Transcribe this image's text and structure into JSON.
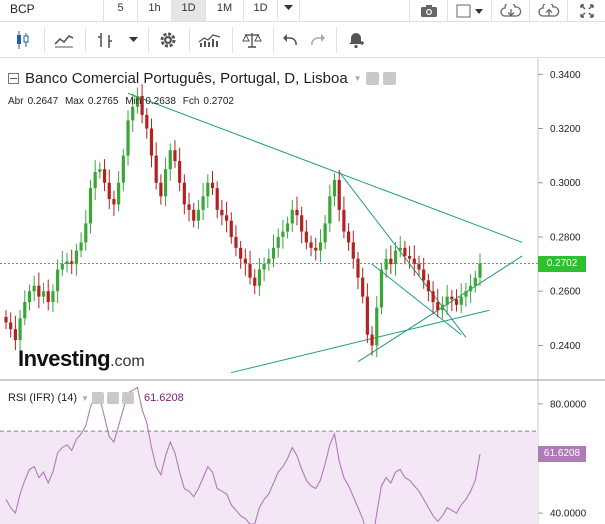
{
  "toolbar": {
    "symbol": "BCP",
    "timeframes": [
      {
        "label": "5",
        "active": false
      },
      {
        "label": "1h",
        "active": false
      },
      {
        "label": "1D",
        "active": true
      },
      {
        "label": "1M",
        "active": false
      },
      {
        "label": "1D",
        "active": false
      }
    ],
    "right_icons": [
      "camera-icon",
      "chart-type-icon",
      "cloud-download-icon",
      "cloud-upload-icon",
      "fullscreen-icon"
    ],
    "row2_icons": [
      "candlestick-icon",
      "line-chart-icon",
      "bar-chart-icon",
      "dropdown-icon",
      "gear-icon",
      "indicators-icon",
      "scales-icon",
      "undo-icon",
      "redo-icon",
      "alert-icon"
    ]
  },
  "chart": {
    "title": "Banco Comercial Português, Portugal, D, Lisboa",
    "ohlc": {
      "open_label": "Abr",
      "open": "0.2647",
      "high_label": "Max",
      "high": "0.2765",
      "low_label": "Min",
      "low": "0.2638",
      "close_label": "Fch",
      "close": "0.2702"
    },
    "price_axis": [
      "0.3400",
      "0.3200",
      "0.3000",
      "0.2800",
      "0.2600",
      "0.2400"
    ],
    "current_price": "0.2702",
    "logo_main": "Investing",
    "logo_suffix": ".com",
    "colors": {
      "up": "#3aa63a",
      "down": "#b22222",
      "trend": "#1e9e7e",
      "price_line": "#2fc02f",
      "rsi": "#b07ab8"
    }
  },
  "rsi": {
    "label": "RSI (IFR) (14)",
    "value": "61.6208",
    "axis": [
      "80.0000",
      "40.0000"
    ]
  },
  "chart_data": {
    "type": "candlestick",
    "title": "Banco Comercial Português, Portugal, D, Lisboa",
    "ylim": [
      0.228,
      0.346
    ],
    "closes": [
      0.2485,
      0.246,
      0.242,
      0.25,
      0.256,
      0.26,
      0.262,
      0.258,
      0.26,
      0.256,
      0.26,
      0.268,
      0.27,
      0.271,
      0.27,
      0.275,
      0.278,
      0.285,
      0.298,
      0.304,
      0.305,
      0.3,
      0.294,
      0.292,
      0.3,
      0.31,
      0.323,
      0.328,
      0.332,
      0.325,
      0.32,
      0.31,
      0.3,
      0.295,
      0.305,
      0.312,
      0.308,
      0.3,
      0.292,
      0.29,
      0.286,
      0.29,
      0.295,
      0.3,
      0.298,
      0.29,
      0.288,
      0.286,
      0.28,
      0.276,
      0.272,
      0.27,
      0.265,
      0.262,
      0.268,
      0.27,
      0.272,
      0.276,
      0.28,
      0.282,
      0.285,
      0.29,
      0.288,
      0.282,
      0.278,
      0.276,
      0.275,
      0.278,
      0.285,
      0.295,
      0.301,
      0.29,
      0.282,
      0.278,
      0.272,
      0.265,
      0.258,
      0.244,
      0.24,
      0.254,
      0.268,
      0.272,
      0.27,
      0.275,
      0.276,
      0.273,
      0.272,
      0.27,
      0.268,
      0.264,
      0.26,
      0.256,
      0.253,
      0.255,
      0.258,
      0.257,
      0.255,
      0.258,
      0.26,
      0.262,
      0.265,
      0.2702
    ],
    "rsi_ylim": [
      36,
      88
    ],
    "rsi": [
      45,
      42,
      40,
      47,
      52,
      56,
      57,
      53,
      55,
      51,
      55,
      62,
      64,
      65,
      63,
      67,
      69,
      72,
      79,
      82,
      82,
      75,
      68,
      66,
      72,
      78,
      84,
      85,
      86,
      78,
      73,
      64,
      57,
      54,
      61,
      66,
      62,
      55,
      49,
      48,
      46,
      49,
      53,
      57,
      55,
      49,
      48,
      47,
      43,
      41,
      39,
      38,
      36,
      36,
      42,
      45,
      47,
      51,
      55,
      57,
      60,
      64,
      61,
      56,
      52,
      50,
      49,
      52,
      58,
      65,
      69,
      59,
      53,
      50,
      46,
      42,
      38,
      31,
      29,
      40,
      50,
      53,
      51,
      55,
      56,
      53,
      52,
      50,
      48,
      45,
      42,
      39,
      37,
      39,
      42,
      41,
      40,
      43,
      45,
      48,
      52,
      61.62
    ]
  }
}
